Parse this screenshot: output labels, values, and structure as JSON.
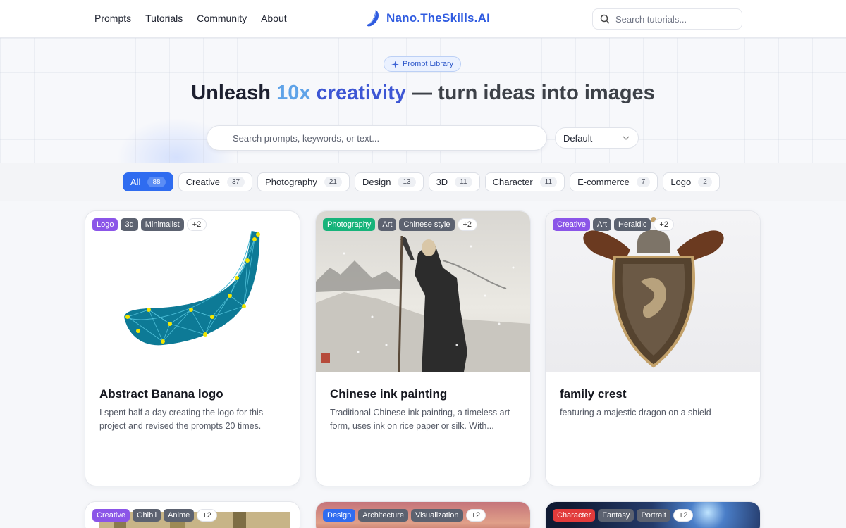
{
  "nav": {
    "links": [
      "Prompts",
      "Tutorials",
      "Community",
      "About"
    ],
    "brand": "Nano.TheSkills.AI",
    "search_placeholder": "Search tutorials..."
  },
  "hero": {
    "badge": "Prompt Library",
    "title_part1": "Unleash ",
    "title_accent1": "10x",
    "title_accent2": " creativity",
    "title_rest": " — turn ideas into images",
    "search_placeholder": "Search prompts, keywords, or text...",
    "sort_value": "Default"
  },
  "categories": [
    {
      "label": "All",
      "count": "88",
      "active": true
    },
    {
      "label": "Creative",
      "count": "37"
    },
    {
      "label": "Photography",
      "count": "21"
    },
    {
      "label": "Design",
      "count": "13"
    },
    {
      "label": "3D",
      "count": "11"
    },
    {
      "label": "Character",
      "count": "11"
    },
    {
      "label": "E-commerce",
      "count": "7"
    },
    {
      "label": "Logo",
      "count": "2"
    }
  ],
  "cards": [
    {
      "tags": [
        {
          "label": "Logo",
          "color": "#8b55e8"
        },
        {
          "label": "3d",
          "color": "#5c6270"
        },
        {
          "label": "Minimalist",
          "color": "#5c6270"
        },
        {
          "label": "+2",
          "more": true
        }
      ],
      "title": "Abstract Banana logo",
      "desc": "I spent half a day creating the logo for this project and revised the prompts 20 times."
    },
    {
      "tags": [
        {
          "label": "Photography",
          "color": "#17b37a"
        },
        {
          "label": "Art",
          "color": "#5c6270"
        },
        {
          "label": "Chinese style",
          "color": "#5c6270"
        },
        {
          "label": "+2",
          "more": true
        }
      ],
      "title": "Chinese ink painting",
      "desc": "Traditional Chinese ink painting, a timeless art form, uses ink on rice paper or silk. With..."
    },
    {
      "tags": [
        {
          "label": "Creative",
          "color": "#8b55e8"
        },
        {
          "label": "Art",
          "color": "#5c6270"
        },
        {
          "label": "Heraldic",
          "color": "#5c6270"
        },
        {
          "label": "+2",
          "more": true
        }
      ],
      "title": "family crest",
      "desc": "featuring a majestic dragon on a shield"
    },
    {
      "tags": [
        {
          "label": "Creative",
          "color": "#8b55e8"
        },
        {
          "label": "Ghibli",
          "color": "#5c6270"
        },
        {
          "label": "Anime",
          "color": "#5c6270"
        },
        {
          "label": "+2",
          "more": true
        }
      ]
    },
    {
      "tags": [
        {
          "label": "Design",
          "color": "#2f6cf0"
        },
        {
          "label": "Architecture",
          "color": "#5c6270"
        },
        {
          "label": "Visualization",
          "color": "#5c6270"
        },
        {
          "label": "+2",
          "more": true
        }
      ]
    },
    {
      "tags": [
        {
          "label": "Character",
          "color": "#e23b3b"
        },
        {
          "label": "Fantasy",
          "color": "#5c6270"
        },
        {
          "label": "Portrait",
          "color": "#5c6270"
        },
        {
          "label": "+2",
          "more": true
        }
      ]
    }
  ]
}
